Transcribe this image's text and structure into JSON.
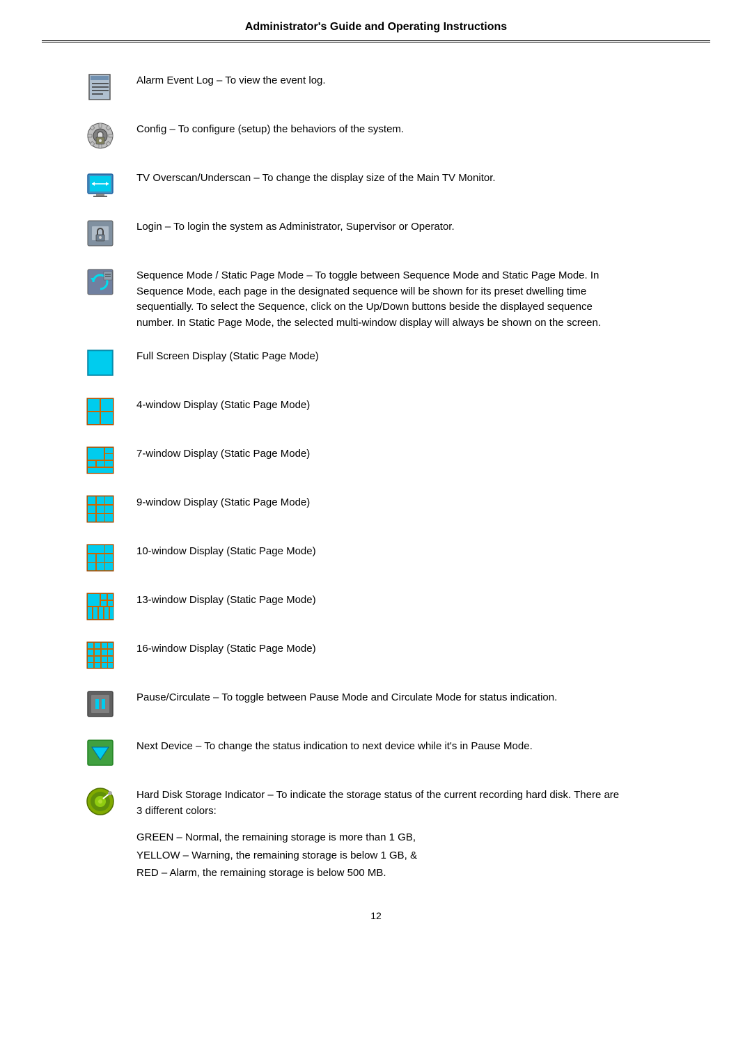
{
  "header": {
    "title": "Administrator's Guide and Operating Instructions"
  },
  "items": [
    {
      "id": "alarm-event-log",
      "icon_type": "alarm_log",
      "text": "Alarm Event Log – To view the event log."
    },
    {
      "id": "config",
      "icon_type": "config",
      "text": "Config – To configure (setup) the behaviors of the system."
    },
    {
      "id": "tv-overscan",
      "icon_type": "tv_overscan",
      "text": "TV Overscan/Underscan – To change the display size of the Main TV Monitor."
    },
    {
      "id": "login",
      "icon_type": "login",
      "text": "Login – To login the system as Administrator, Supervisor or Operator."
    },
    {
      "id": "sequence-mode",
      "icon_type": "sequence",
      "text": "Sequence Mode / Static Page Mode – To toggle between Sequence Mode and Static Page Mode.   In Sequence Mode, each page in the designated sequence will be shown for its preset dwelling time sequentially.   To select the Sequence, click on the Up/Down buttons beside the displayed sequence number.   In Static Page Mode, the selected multi-window display will always be shown on the screen."
    },
    {
      "id": "full-screen",
      "icon_type": "full_screen",
      "text": "Full Screen Display (Static Page Mode)"
    },
    {
      "id": "4-window",
      "icon_type": "window_4",
      "text": "4-window Display (Static Page Mode)"
    },
    {
      "id": "7-window",
      "icon_type": "window_7",
      "text": "7-window Display (Static Page Mode)"
    },
    {
      "id": "9-window",
      "icon_type": "window_9",
      "text": "9-window Display (Static Page Mode)"
    },
    {
      "id": "10-window",
      "icon_type": "window_10",
      "text": "10-window Display (Static Page Mode)"
    },
    {
      "id": "13-window",
      "icon_type": "window_13",
      "text": "13-window Display (Static Page Mode)"
    },
    {
      "id": "16-window",
      "icon_type": "window_16",
      "text": "16-window Display (Static Page Mode)"
    },
    {
      "id": "pause-circulate",
      "icon_type": "pause_circulate",
      "text": "Pause/Circulate – To toggle between Pause Mode and Circulate Mode for status indication."
    },
    {
      "id": "next-device",
      "icon_type": "next_device",
      "text": "Next Device – To change the status indication to next device while it's in Pause Mode."
    },
    {
      "id": "hard-disk",
      "icon_type": "hard_disk",
      "text": "Hard Disk Storage Indicator – To indicate the storage status of the current recording hard disk.   There are 3 different colors:",
      "sub_text": "GREEN – Normal, the remaining storage is more than 1 GB,\nYELLOW – Warning, the remaining storage is below 1 GB, &\nRED – Alarm, the remaining storage is below 500 MB."
    }
  ],
  "footer": {
    "page_number": "12"
  }
}
